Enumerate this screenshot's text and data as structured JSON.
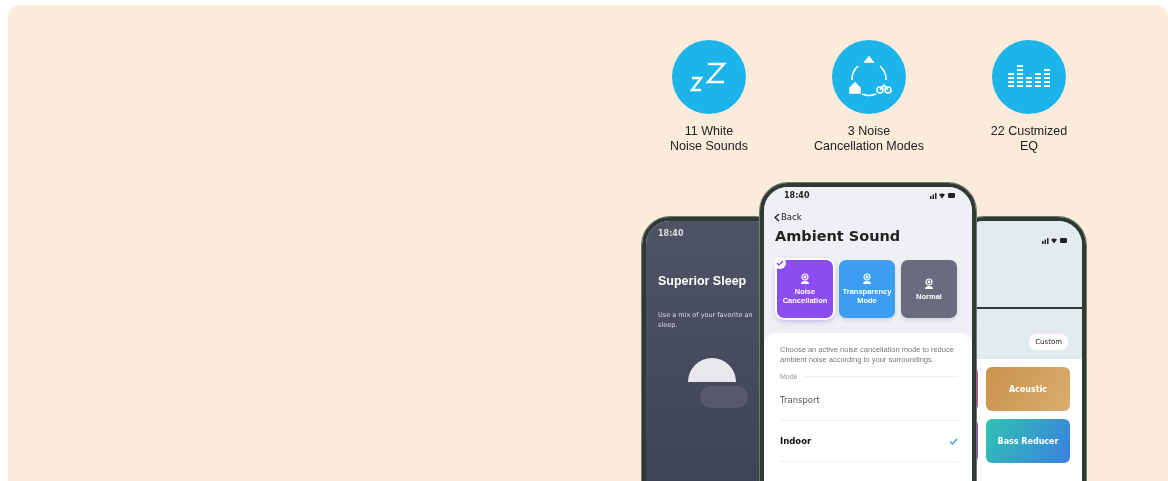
{
  "features": [
    {
      "kind": "sleep",
      "lines": [
        "11 White",
        "Noise Sounds"
      ]
    },
    {
      "kind": "modes",
      "lines": [
        "3 Noise",
        "Cancellation Modes"
      ]
    },
    {
      "kind": "eq",
      "lines": [
        "22 Custmized",
        "EQ"
      ]
    }
  ],
  "sleep_phone": {
    "time": "18:40",
    "title": "Superior Sleep",
    "description": [
      "Use a mix of your favorite an",
      "sleep."
    ]
  },
  "ambient_phone": {
    "time": "18:40",
    "back": "Back",
    "title": "Ambient Sound",
    "modes": [
      {
        "lines": [
          "Noise",
          "Cancellation"
        ],
        "selected": true,
        "color": "#8b4cf0"
      },
      {
        "lines": [
          "Transparency",
          "Mode"
        ],
        "selected": false,
        "color": "#3b9ef0"
      },
      {
        "lines": [
          "Normal"
        ],
        "selected": false,
        "color": "#6b6b80"
      }
    ],
    "description": "Choose an active noise cancellation mode to reduce ambient noise according to your surroundings.",
    "section": "Mode",
    "options": [
      {
        "label": "Transport",
        "selected": false
      },
      {
        "label": "Indoor",
        "selected": true
      }
    ]
  },
  "eq_phone": {
    "custom": "Custom",
    "presets": [
      {
        "kind": "acoustic",
        "label": "Acoustic"
      },
      {
        "kind": "bass",
        "label": "Bass Reducer"
      }
    ]
  }
}
